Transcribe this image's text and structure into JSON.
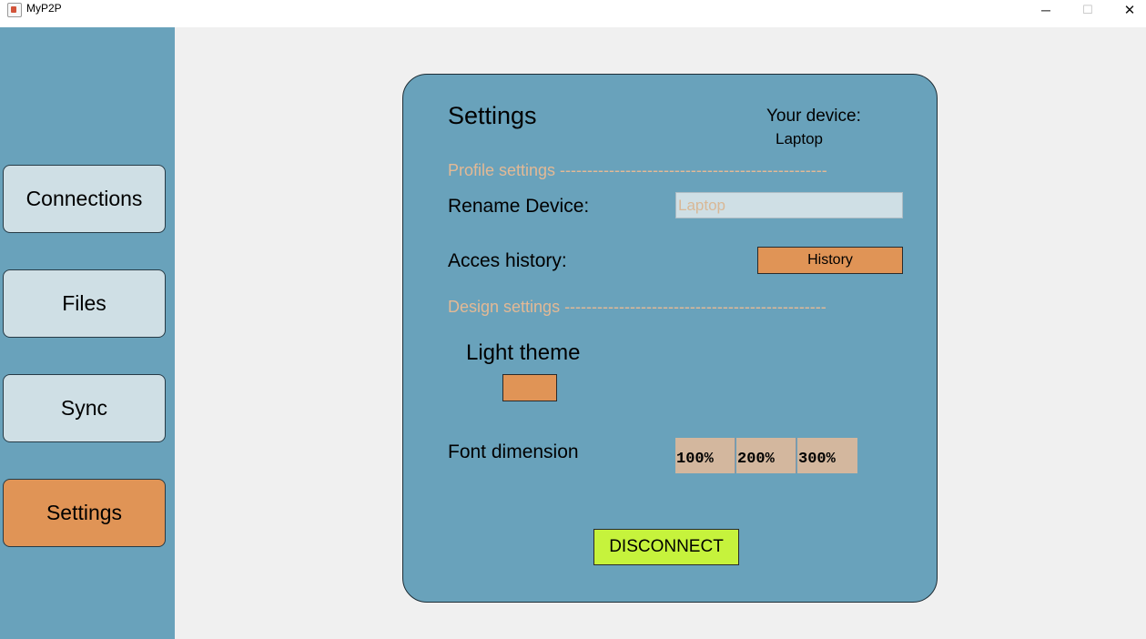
{
  "window": {
    "title": "MyP2P",
    "controls": {
      "minimize": "─",
      "maximize": "☐",
      "close": "✕"
    }
  },
  "sidebar": {
    "items": [
      {
        "label": "Connections",
        "active": false
      },
      {
        "label": "Files",
        "active": false
      },
      {
        "label": "Sync",
        "active": false
      },
      {
        "label": "Settings",
        "active": true
      }
    ]
  },
  "settings": {
    "title": "Settings",
    "device_label": "Your device:",
    "device_name": "Laptop",
    "profile_section": "Profile settings -------------------------------------------------",
    "rename_label": "Rename Device:",
    "rename_placeholder": "Laptop",
    "history_label": "Acces history:",
    "history_button": "History",
    "design_section": "Design settings ------------------------------------------------",
    "theme_label": "Light theme",
    "font_label": "Font dimension",
    "font_options": [
      "100%",
      "200%",
      "300%"
    ],
    "disconnect_button": "DISCONNECT"
  },
  "colors": {
    "sidebar_bg": "#69a2bb",
    "panel_bg": "#69a2bb",
    "nav_button_bg": "#cfdfe5",
    "accent_orange": "#e09456",
    "section_text": "#e3b995",
    "font_button_bg": "#d3b79e",
    "disconnect_bg": "#c6f33c"
  }
}
